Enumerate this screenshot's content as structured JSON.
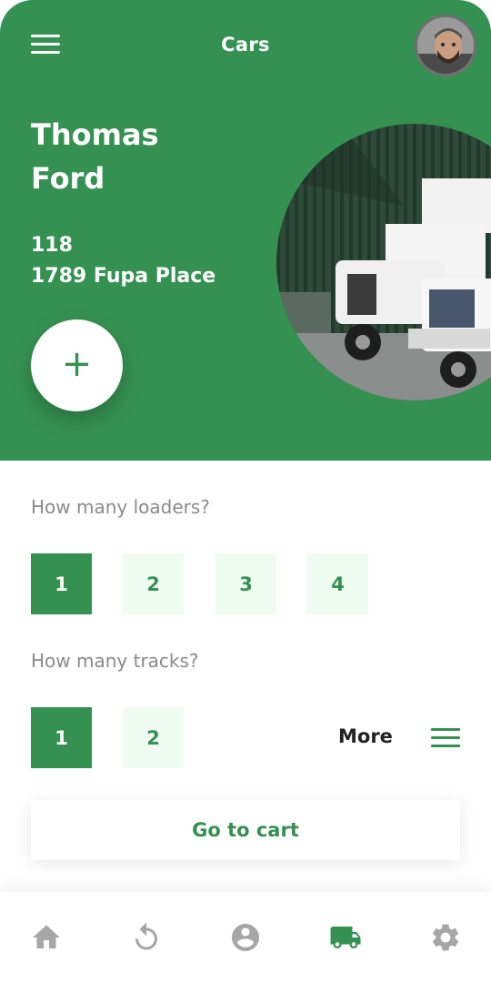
{
  "header": {
    "title": "Cars"
  },
  "profile": {
    "first_name": "Thomas",
    "last_name": "Ford",
    "address_line1": "118",
    "address_line2": "1789 Fupa Place"
  },
  "add_button": {
    "label": "+"
  },
  "loaders": {
    "question": "How many loaders?",
    "options": [
      "1",
      "2",
      "3",
      "4"
    ],
    "selected": "1"
  },
  "tracks": {
    "question": "How many tracks?",
    "options": [
      "1",
      "2"
    ],
    "selected": "1",
    "more_label": "More"
  },
  "cart": {
    "label": "Go to cart"
  },
  "nav": {
    "items": [
      {
        "icon": "home-icon"
      },
      {
        "icon": "history-icon"
      },
      {
        "icon": "profile-icon"
      },
      {
        "icon": "truck-icon",
        "active": true
      },
      {
        "icon": "settings-icon"
      }
    ]
  },
  "colors": {
    "primary": "#359151",
    "light": "#effcf2",
    "muted": "#8a8a8a",
    "inactive_icon": "#a6a6a6"
  }
}
